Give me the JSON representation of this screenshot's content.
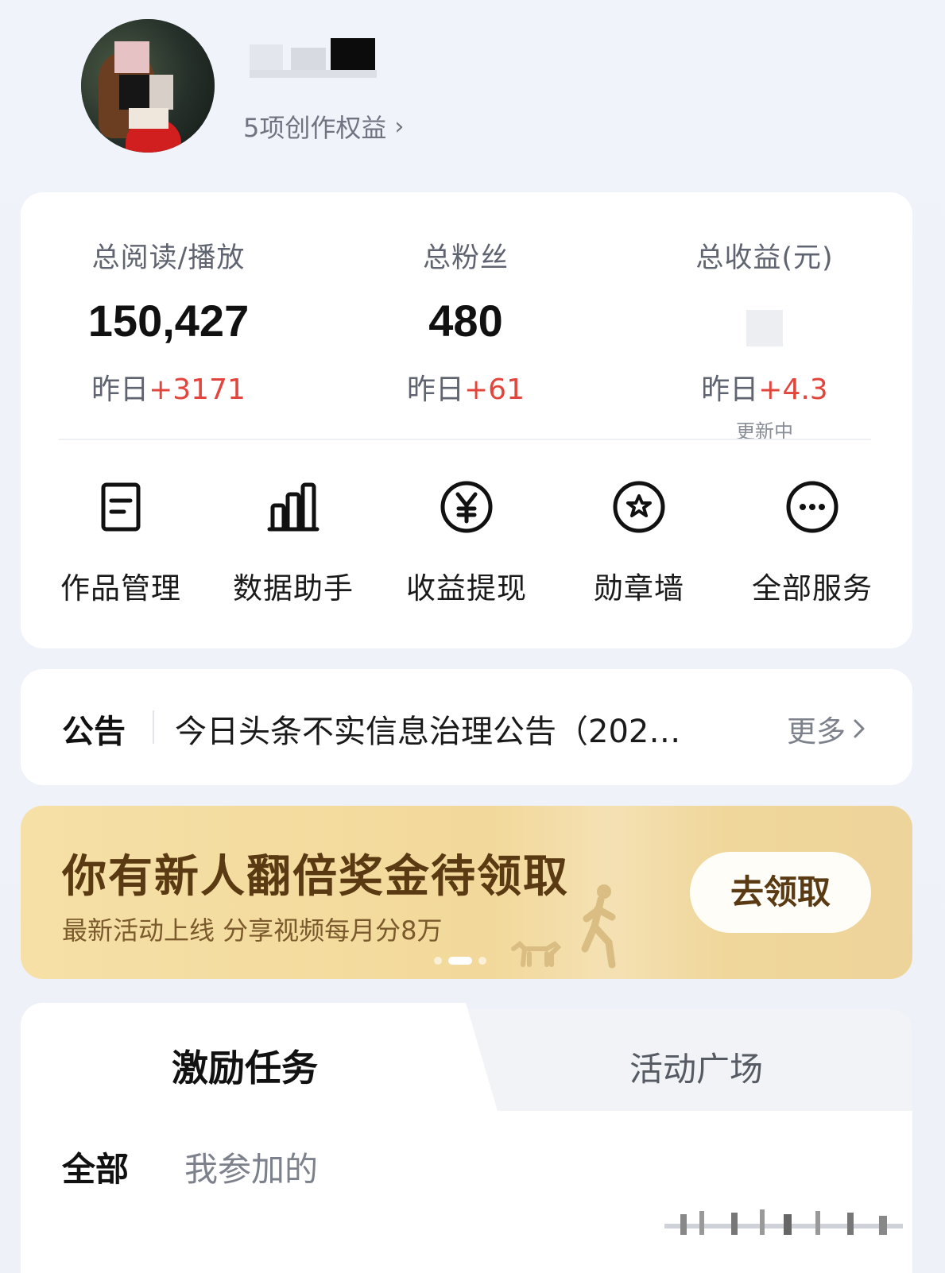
{
  "profile": {
    "privileges_label": "5项创作权益",
    "chevron": "›"
  },
  "stats": {
    "reads": {
      "label": "总阅读/播放",
      "value": "150,427",
      "delta_prefix": "昨日",
      "delta_value": "+3171"
    },
    "fans": {
      "label": "总粉丝",
      "value": "480",
      "delta_prefix": "昨日",
      "delta_value": "+61"
    },
    "income": {
      "label": "总收益(元)",
      "delta_prefix": "昨日",
      "delta_value": "+4.3",
      "note": "更新中"
    }
  },
  "tools": [
    {
      "label": "作品管理",
      "icon": "document-icon"
    },
    {
      "label": "数据助手",
      "icon": "bar-chart-icon"
    },
    {
      "label": "收益提现",
      "icon": "yen-coin-icon"
    },
    {
      "label": "勋章墙",
      "icon": "medal-star-icon"
    },
    {
      "label": "全部服务",
      "icon": "more-dots-icon"
    }
  ],
  "notice": {
    "title": "公告",
    "text": "今日头条不实信息治理公告（202…",
    "more": "更多"
  },
  "banner": {
    "title": "你有新人翻倍奖金待领取",
    "subtitle": "最新活动上线 分享视频每月分8万",
    "button": "去领取"
  },
  "tabs": {
    "active": "激励任务",
    "inactive": "活动广场",
    "filter_all": "全部",
    "filter_mine": "我参加的"
  },
  "colors": {
    "accent_red": "#e2453c",
    "banner_gold": "#f2d89a",
    "banner_text": "#5a3a12"
  }
}
